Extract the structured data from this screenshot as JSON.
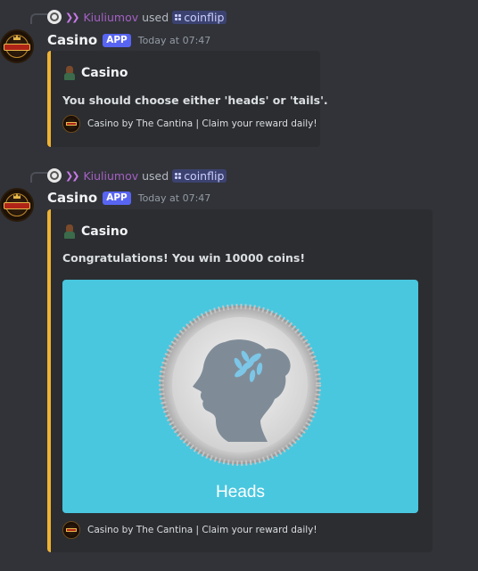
{
  "messages": [
    {
      "reply": {
        "user": "Kiuliumov",
        "used": "used",
        "command": "coinflip"
      },
      "author": "Casino",
      "tag": "APP",
      "timestamp": "Today at 07:47",
      "embed": {
        "author": "Casino",
        "description": "You should choose either 'heads' or 'tails'.",
        "footer": "Casino by The Cantina | Claim your reward daily!"
      }
    },
    {
      "reply": {
        "user": "Kiuliumov",
        "used": "used",
        "command": "coinflip"
      },
      "author": "Casino",
      "tag": "APP",
      "timestamp": "Today at 07:47",
      "embed": {
        "author": "Casino",
        "description": "Congratulations! You win 10000 coins!",
        "image_label": "Heads",
        "footer": "Casino by The Cantina | Claim your reward daily!"
      }
    }
  ],
  "colors": {
    "background": "#313338",
    "embed_background": "#2b2d31",
    "embed_accent": "#f0b232",
    "app_tag": "#5865f2",
    "image_background": "#49c7df"
  },
  "icons": {
    "reply_avatar": "globe-avatar-icon",
    "command": "slash-command-icon",
    "bot_avatar": "casino-logo-icon",
    "embed_author": "casino-dealer-icon",
    "footer": "casino-logo-icon"
  }
}
